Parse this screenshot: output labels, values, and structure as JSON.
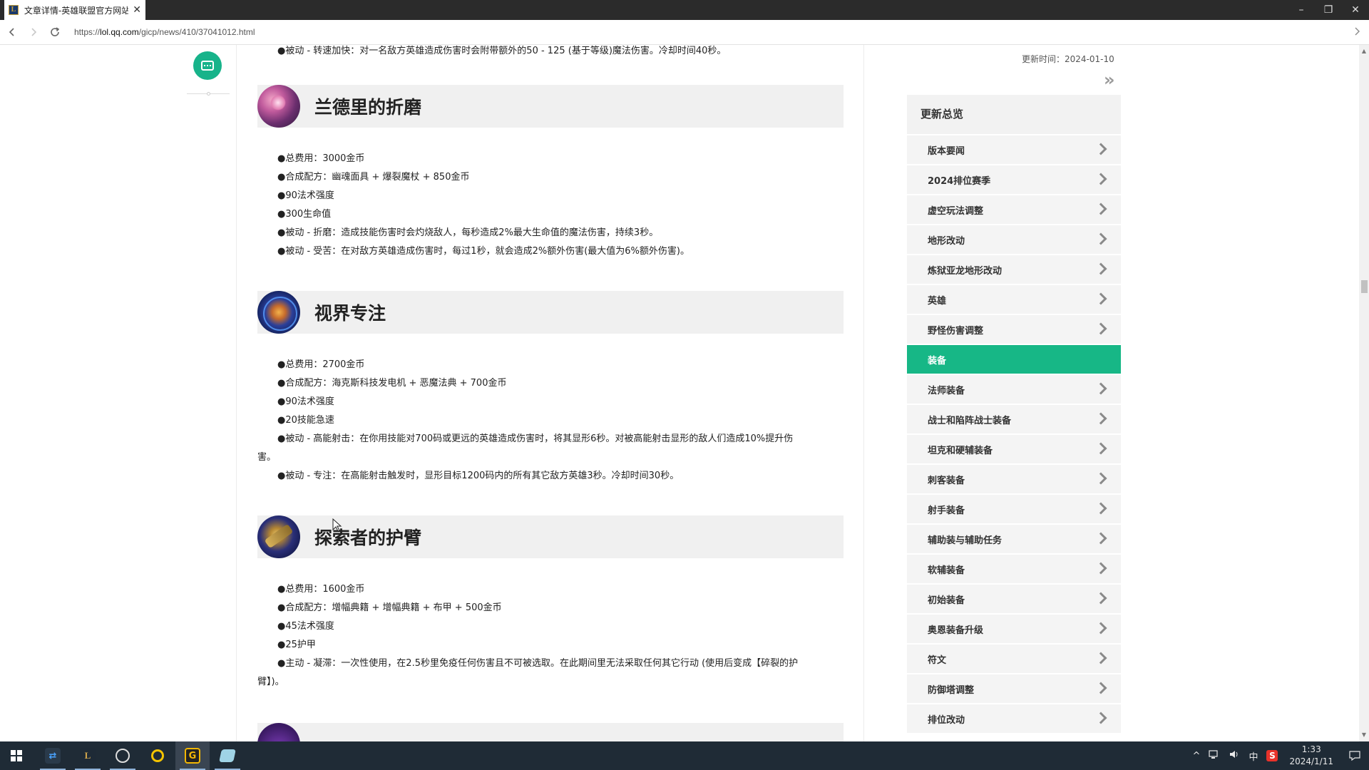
{
  "browser": {
    "tab_title": "文章详情-英雄联盟官方网站",
    "tab_favicon_letter": "L",
    "url_prefix": "https://",
    "url_host": "lol.qq.com",
    "url_path": "/gicp/news/410/37041012.html",
    "win_min": "–",
    "win_restore": "❐",
    "win_close": "✕"
  },
  "article": {
    "top_line": "●被动 - 转速加快：对一名敌方英雄造成伤害时会附带额外的50 - 125 (基于等级)魔法伤害。冷却时间40秒。",
    "items": [
      {
        "title": "兰德里的折磨",
        "icon": "liandry-item-icon",
        "lines": [
          "●总费用：3000金币",
          "●合成配方：幽魂面具 + 爆裂魔杖 + 850金币",
          "●90法术强度",
          "●300生命值",
          "●被动 - 折磨：造成技能伤害时会灼烧敌人，每秒造成2%最大生命值的魔法伤害，持续3秒。",
          "●被动 - 受苦：在对敌方英雄造成伤害时，每过1秒，就会造成2%额外伤害(最大值为6%额外伤害)。"
        ]
      },
      {
        "title": "视界专注",
        "icon": "horizon-focus-item-icon",
        "lines": [
          "●总费用：2700金币",
          "●合成配方：海克斯科技发电机 + 恶魔法典 + 700金币",
          "●90法术强度",
          "●20技能急速"
        ],
        "wrap_line_a": "●被动 - 高能射击：在你用技能对700码或更远的英雄造成伤害时，将其显形6秒。对被高能射击显形的敌人们造成10%提升伤",
        "wrap_line_b": "害。",
        "last_line": "●被动 - 专注：在高能射击触发时，显形目标1200码内的所有其它敌方英雄3秒。冷却时间30秒。"
      },
      {
        "title": "探索者的护臂",
        "icon": "seekers-armguard-item-icon",
        "lines": [
          "●总费用：1600金币",
          "●合成配方：增幅典籍 + 增幅典籍 + 布甲 + 500金币",
          "●45法术强度",
          "●25护甲"
        ],
        "wrap_line_a": "●主动 - 凝滞：一次性使用，在2.5秒里免疫任何伤害且不可被选取。在此期间里无法采取任何其它行动 (使用后变成【碎裂的护",
        "wrap_line_b": "臂】)。"
      }
    ]
  },
  "sidebar": {
    "update_time": "更新时间：2024-01-10",
    "expand_glyph": "»",
    "header": "更新总览",
    "items": [
      {
        "label": "版本要闻",
        "active": false
      },
      {
        "label": "2024排位赛季",
        "active": false
      },
      {
        "label": "虚空玩法调整",
        "active": false
      },
      {
        "label": "地形改动",
        "active": false
      },
      {
        "label": "炼狱亚龙地形改动",
        "active": false
      },
      {
        "label": "英雄",
        "active": false
      },
      {
        "label": "野怪伤害调整",
        "active": false
      },
      {
        "label": "装备",
        "active": true
      },
      {
        "label": "法师装备",
        "active": false
      },
      {
        "label": "战士和陷阵战士装备",
        "active": false
      },
      {
        "label": "坦克和硬辅装备",
        "active": false
      },
      {
        "label": "刺客装备",
        "active": false
      },
      {
        "label": "射手装备",
        "active": false
      },
      {
        "label": "辅助装与辅助任务",
        "active": false
      },
      {
        "label": "软辅装备",
        "active": false
      },
      {
        "label": "初始装备",
        "active": false
      },
      {
        "label": "奥恩装备升级",
        "active": false
      },
      {
        "label": "符文",
        "active": false
      },
      {
        "label": "防御塔调整",
        "active": false
      },
      {
        "label": "排位改动",
        "active": false
      }
    ]
  },
  "taskbar": {
    "clock_time": "1:33",
    "clock_date": "2024/1/11",
    "tray_chevron": "^",
    "tray_ime": "中",
    "apps": [
      "teamviewer-icon",
      "league-client-icon",
      "speedtest-icon",
      "circle-app-icon",
      "g-app-icon",
      "notes-app-icon"
    ]
  },
  "colors": {
    "accent": "#17b786",
    "taskbar": "#1f2b36",
    "titlebar": "#2b2b2b"
  }
}
